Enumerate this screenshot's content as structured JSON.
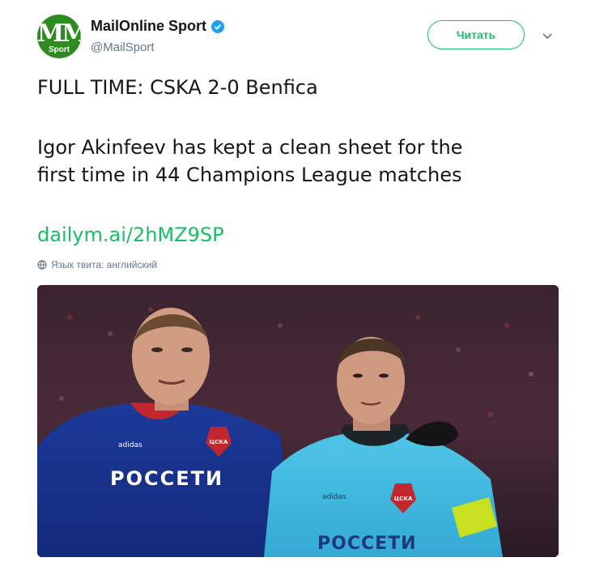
{
  "account": {
    "display_name": "MailOnline Sport",
    "handle": "@MailSport",
    "avatar_letters": "MM",
    "avatar_tag": "Sport",
    "verified": true
  },
  "follow_button": {
    "label": "Читать"
  },
  "tweet": {
    "line1": "FULL TIME: CSKA 2-0 Benfica",
    "line2": "Igor Akinfeev has kept a clean sheet for the",
    "line3": "first time in 44 Champions League matches",
    "link": "dailym.ai/2hMZ9SP",
    "language_note": "Язык твита: английский"
  },
  "media": {
    "sponsor_left": "РОССЕТИ",
    "sponsor_right": "РОССЕТИ",
    "club_badge": "ЦСКА",
    "kit_brand": "adidas"
  },
  "colors": {
    "accent": "#17bf63",
    "verified": "#1da1f2",
    "text": "#14171a",
    "muted": "#657786"
  }
}
